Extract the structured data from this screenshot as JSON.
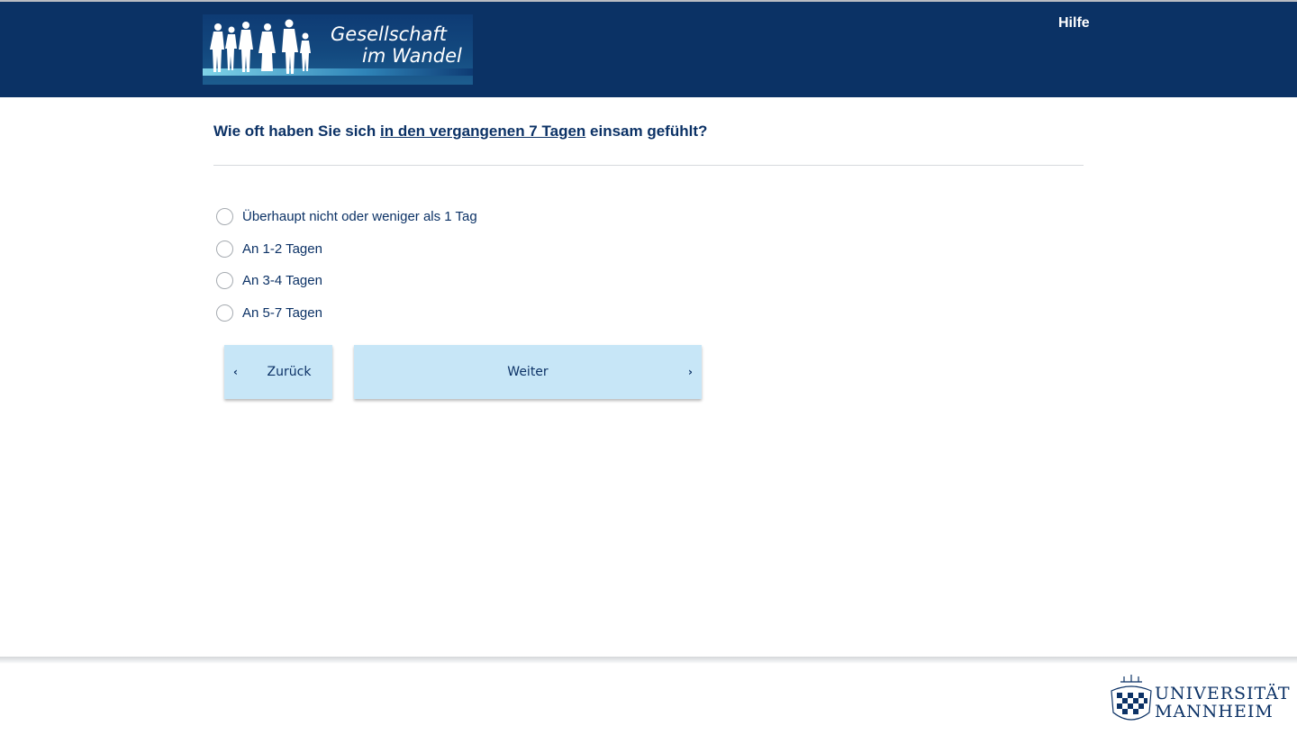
{
  "header": {
    "logo": {
      "line1": "Gesellschaft",
      "line2": "im Wandel",
      "icon": "family-silhouettes-logo"
    },
    "help_label": "Hilfe"
  },
  "question": {
    "prefix": "Wie oft haben Sie sich ",
    "emphasis": "in den vergangenen 7 Tagen",
    "suffix": " einsam gefühlt?"
  },
  "options": [
    {
      "label": "Überhaupt nicht oder weniger als 1 Tag",
      "selected": false
    },
    {
      "label": "An 1-2 Tagen",
      "selected": false
    },
    {
      "label": "An 3-4 Tagen",
      "selected": false
    },
    {
      "label": "An 5-7 Tagen",
      "selected": false
    }
  ],
  "navigation": {
    "back_label": "Zurück",
    "back_icon": "chevron-left-icon",
    "next_label": "Weiter",
    "next_icon": "chevron-right-icon"
  },
  "footer": {
    "university_line1": "UNIVERSITÄT",
    "university_line2": "MANNHEIM",
    "seal_icon": "university-seal-icon"
  },
  "colors": {
    "header_bg": "#0b3265",
    "text": "#0c3266",
    "button_bg": "#c7e6f7"
  }
}
